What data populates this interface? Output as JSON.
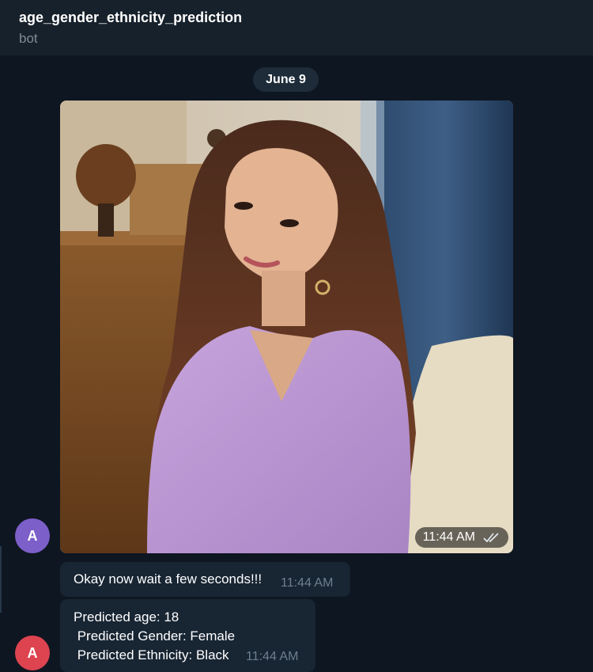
{
  "header": {
    "title": "age_gender_ethnicity_prediction",
    "subtitle": "bot"
  },
  "date_separator": "June 9",
  "photo_message": {
    "time": "11:44 AM",
    "status_icon": "double-check-icon"
  },
  "messages": [
    {
      "text": "Okay now wait a few seconds!!!",
      "time": "11:44 AM"
    },
    {
      "lines": [
        "Predicted age: 18",
        " Predicted Gender: Female",
        " Predicted Ethnicity: Black"
      ],
      "time": "11:44 AM"
    }
  ],
  "avatars": [
    {
      "letter": "A",
      "color": "#7c5fc9"
    },
    {
      "letter": "A",
      "color": "#de4350"
    }
  ]
}
